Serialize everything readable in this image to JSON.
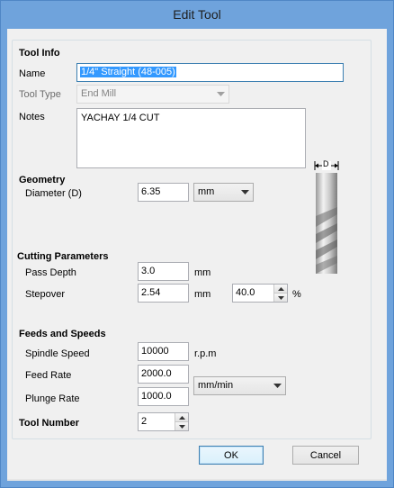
{
  "window": {
    "title": "Edit Tool"
  },
  "tool_info": {
    "heading": "Tool Info",
    "name_label": "Name",
    "name_value": "1/4\" Straight  (48-005)",
    "type_label": "Tool Type",
    "type_value": "End Mill",
    "notes_label": "Notes",
    "notes_value": "YACHAY 1/4 CUT"
  },
  "geometry": {
    "heading": "Geometry",
    "diameter_label": "Diameter (D)",
    "diameter_value": "6.35",
    "units_value": "mm",
    "diagram_label": "D"
  },
  "cutting": {
    "heading": "Cutting Parameters",
    "pass_depth_label": "Pass Depth",
    "pass_depth_value": "3.0",
    "pass_depth_unit": "mm",
    "stepover_label": "Stepover",
    "stepover_value": "2.54",
    "stepover_unit": "mm",
    "stepover_percent_value": "40.0",
    "stepover_percent_unit": "%"
  },
  "feeds": {
    "heading": "Feeds and Speeds",
    "spindle_label": "Spindle Speed",
    "spindle_value": "10000",
    "spindle_unit": "r.p.m",
    "feed_label": "Feed Rate",
    "feed_value": "2000.0",
    "plunge_label": "Plunge Rate",
    "plunge_value": "1000.0",
    "rate_units_value": "mm/min"
  },
  "tool_number": {
    "label": "Tool Number",
    "value": "2"
  },
  "buttons": {
    "ok": "OK",
    "cancel": "Cancel"
  },
  "colors": {
    "frame": "#6fa3dc",
    "client": "#f0f0f0",
    "selection": "#3399ff"
  }
}
